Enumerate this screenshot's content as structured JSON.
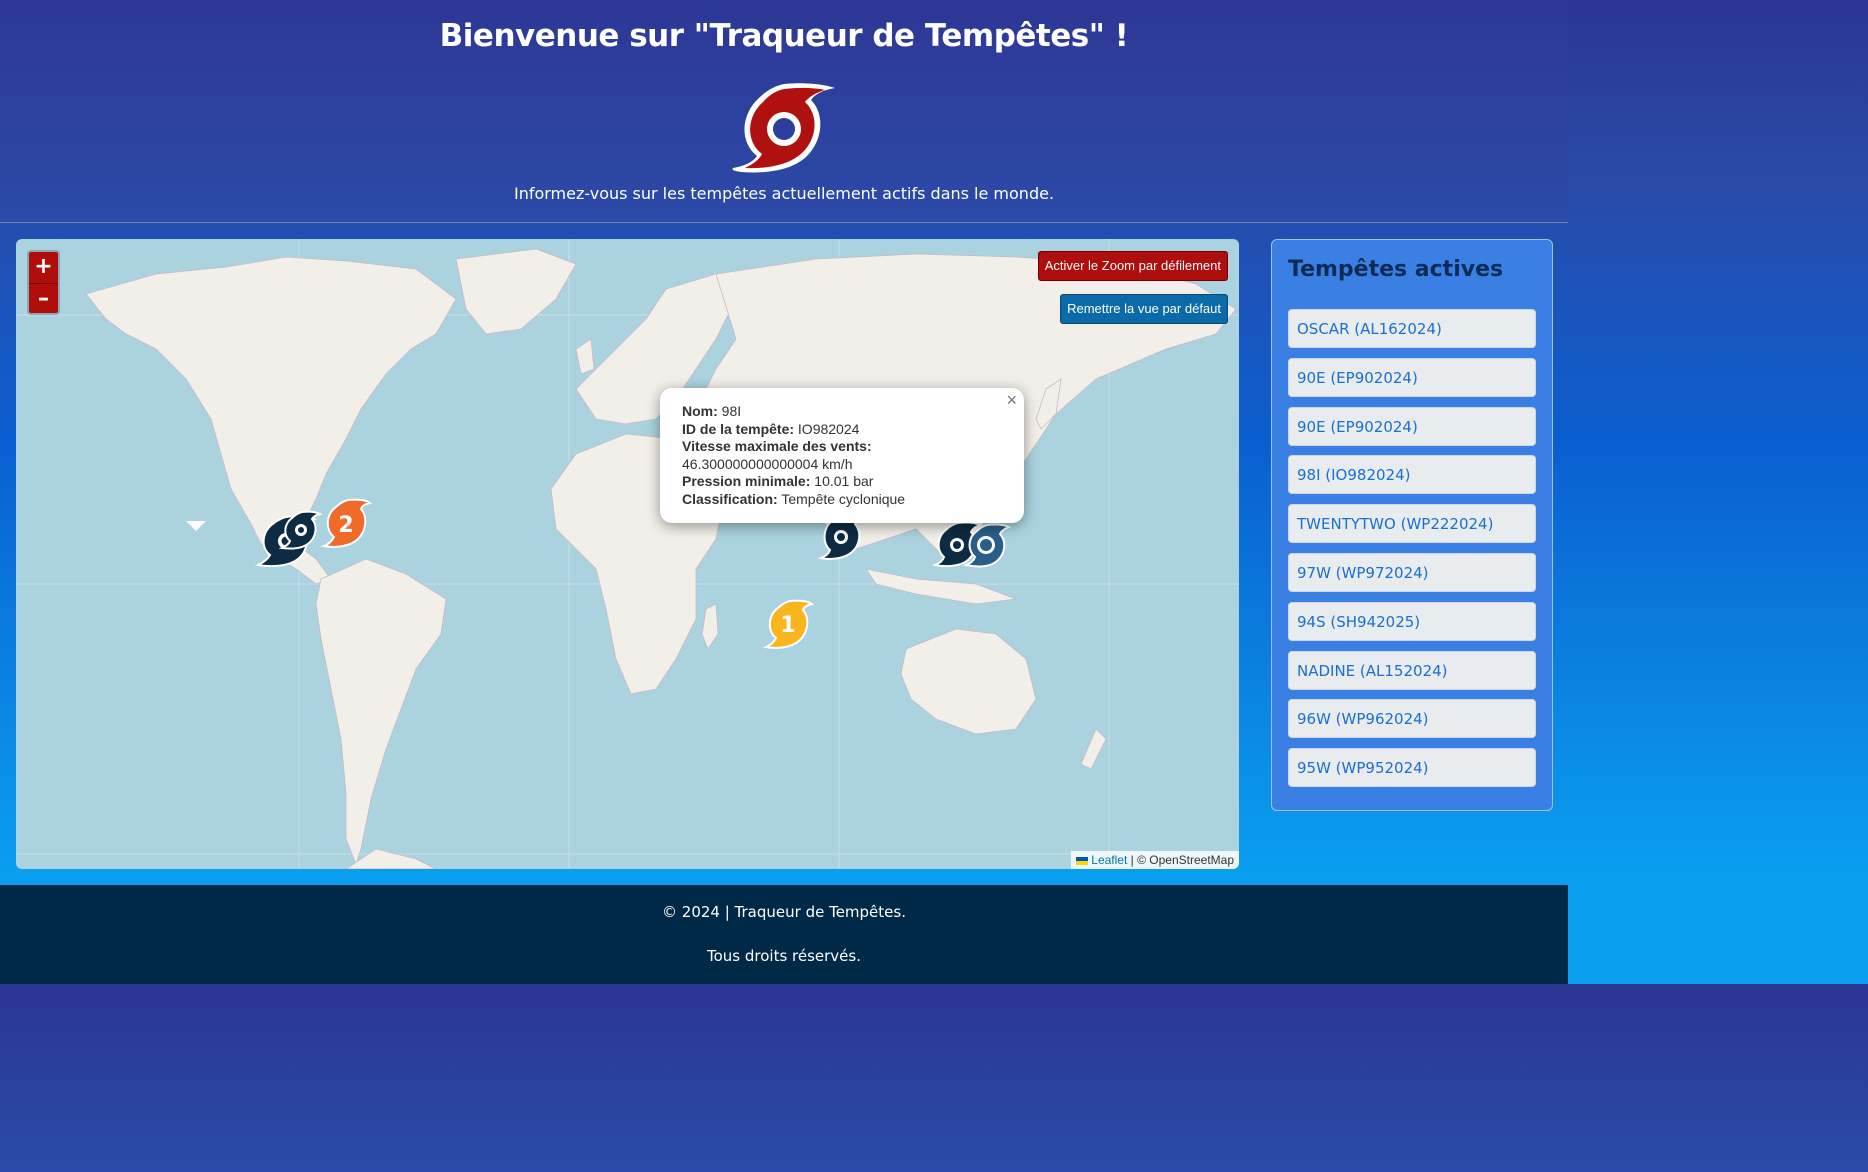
{
  "header": {
    "title": "Bienvenue sur \"Traqueur de Tempêtes\" !",
    "tagline": "Informez-vous sur les tempêtes actuellement actifs dans le monde.",
    "logo_icon": "hurricane-logo-icon",
    "logo_color": "#b01010"
  },
  "map": {
    "zoom_in_label": "+",
    "zoom_out_label": "–",
    "scroll_zoom_button": "Activer le Zoom par défilement",
    "reset_view_button": "Remettre la vue par défaut",
    "attribution_leaflet": "Leaflet",
    "attribution_osm": "| © OpenStreetMap",
    "popup": {
      "name_label": "Nom:",
      "name_value": "98I",
      "id_label": "ID de la tempête:",
      "id_value": "IO982024",
      "wind_label": "Vitesse maximale des vents:",
      "wind_value": "46.300000000000004 km/h",
      "pressure_label": "Pression minimale:",
      "pressure_value": "10.01 bar",
      "class_label": "Classification:",
      "class_value": "Tempête cyclonique",
      "close": "×"
    },
    "markers": [
      {
        "icon": "storm-marker-icon",
        "color": "#0e2b44"
      },
      {
        "icon": "hurricane-cat2-icon",
        "label": "2",
        "color": "#f06a2a"
      },
      {
        "icon": "hurricane-cat1-icon",
        "label": "1",
        "color": "#f8b51c"
      }
    ]
  },
  "sidebar": {
    "title": "Tempêtes actives",
    "storms": [
      "OSCAR (AL162024)",
      "90E (EP902024)",
      "90E (EP902024)",
      "98I (IO982024)",
      "TWENTYTWO (WP222024)",
      "97W (WP972024)",
      "94S (SH942025)",
      "NADINE (AL152024)",
      "96W (WP962024)",
      "95W (WP952024)"
    ]
  },
  "footer": {
    "line1": "© 2024 | Traqueur de Tempêtes.",
    "line2": "Tous droits réservés."
  }
}
